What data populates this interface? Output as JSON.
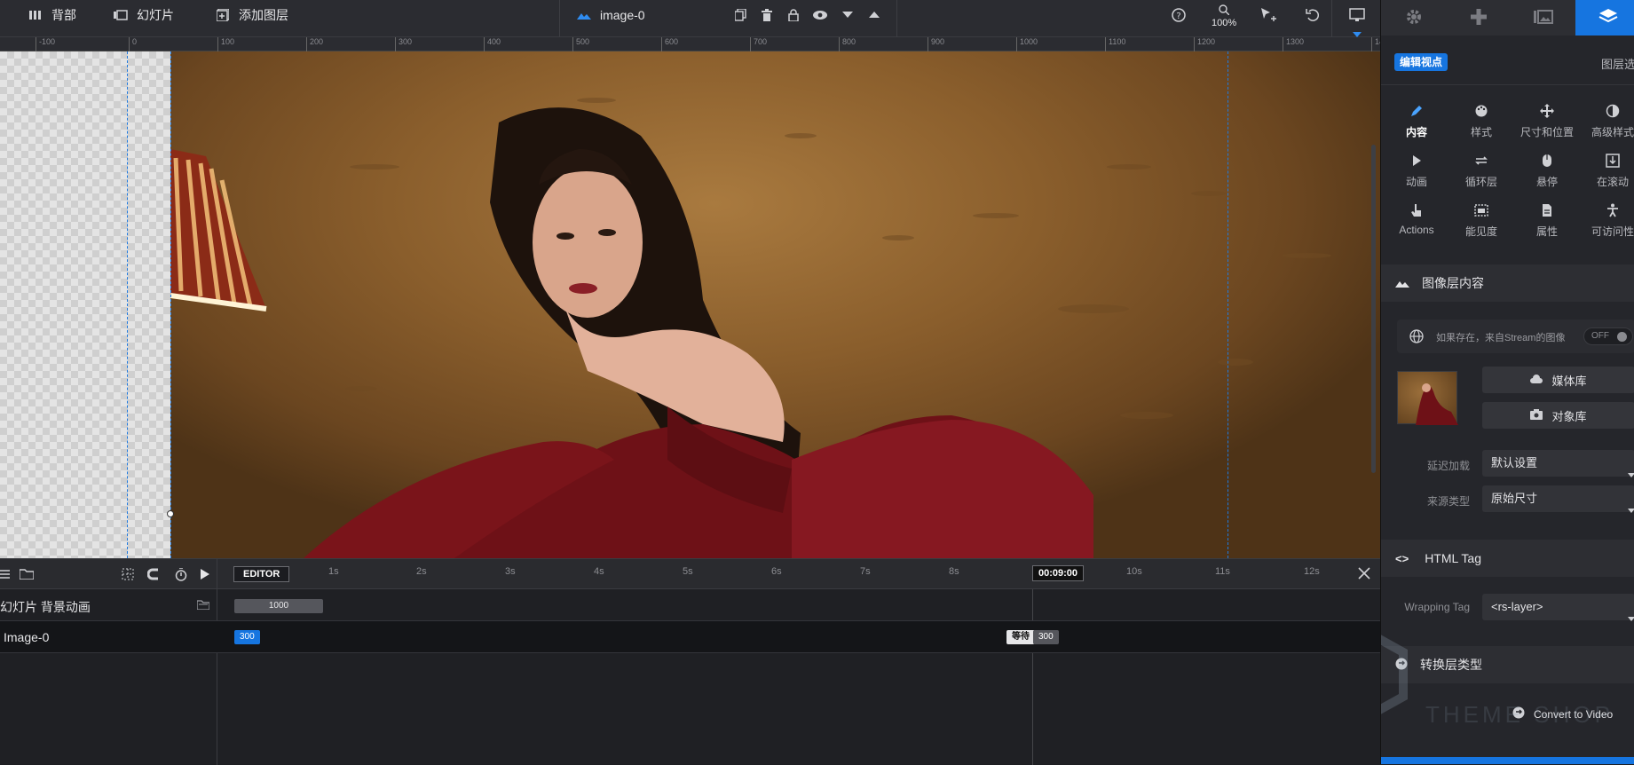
{
  "topbar": {
    "background_label": "背部",
    "slide_label": "幻灯片",
    "add_layer_label": "添加图层",
    "layer_name": "image-0",
    "zoom": "100%"
  },
  "ruler": {
    "ticks": [
      "-100",
      "0",
      "100",
      "200",
      "300",
      "400",
      "500",
      "600",
      "700",
      "800",
      "900",
      "1000",
      "1100",
      "1200",
      "1300",
      "14"
    ]
  },
  "timeline": {
    "editor_label": "EDITOR",
    "seconds": [
      "1s",
      "2s",
      "3s",
      "4s",
      "5s",
      "6s",
      "7s",
      "8s",
      "10s",
      "11s",
      "12s"
    ],
    "current_time": "00:09:00",
    "rows": [
      {
        "name": "幻灯片 背景动画",
        "bar_value": "1000"
      },
      {
        "name": "Image-0",
        "start_value": "300",
        "wait_label": "等待",
        "end_value": "300"
      }
    ]
  },
  "panel": {
    "edit_view_badge": "编辑视点",
    "layer_options_label": "图层选",
    "grid": [
      {
        "label": "内容",
        "icon": "pencil-icon",
        "active": true
      },
      {
        "label": "样式",
        "icon": "palette-icon"
      },
      {
        "label": "尺寸和位置",
        "icon": "move-icon"
      },
      {
        "label": "高级样式",
        "icon": "contrast-icon"
      },
      {
        "label": "动画",
        "icon": "play-icon"
      },
      {
        "label": "循环层",
        "icon": "loop-icon"
      },
      {
        "label": "悬停",
        "icon": "mouse-icon"
      },
      {
        "label": "在滚动",
        "icon": "scroll-icon"
      },
      {
        "label": "Actions",
        "icon": "hand-icon"
      },
      {
        "label": "能见度",
        "icon": "visibility-icon"
      },
      {
        "label": "属性",
        "icon": "document-icon"
      },
      {
        "label": "可访问性",
        "icon": "accessibility-icon"
      }
    ],
    "image_content_title": "图像层内容",
    "stream_label": "如果存在，来自Stream的图像",
    "stream_toggle": "OFF",
    "media_library_label": "媒体库",
    "object_library_label": "对象库",
    "lazy_load_label": "延迟加载",
    "lazy_load_value": "默认设置",
    "source_type_label": "来源类型",
    "source_type_value": "原始尺寸",
    "html_tag_title": "HTML Tag",
    "wrapping_tag_label": "Wrapping Tag",
    "wrapping_tag_value": "<rs-layer>",
    "convert_type_title": "转换层类型",
    "convert_video_label": "Convert to Video",
    "watermark_text": "THEME SHOP"
  },
  "colors": {
    "accent": "#1675e0",
    "panel": "#25262b",
    "topbar": "#2b2c31"
  }
}
